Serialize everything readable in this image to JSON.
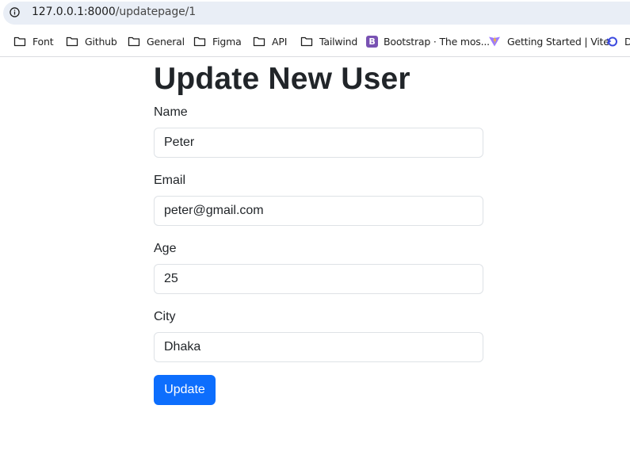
{
  "browser": {
    "url_host": "127.0.0.1:8000",
    "url_path": "/updatepage/1",
    "bookmarks": [
      {
        "label": "Font",
        "icon": "folder-icon"
      },
      {
        "label": "Github",
        "icon": "folder-icon"
      },
      {
        "label": "General",
        "icon": "folder-icon"
      },
      {
        "label": "Figma",
        "icon": "folder-icon"
      },
      {
        "label": "API",
        "icon": "folder-icon"
      },
      {
        "label": "Tailwind",
        "icon": "folder-icon"
      },
      {
        "label": "Bootstrap · The mos...",
        "icon": "bootstrap-icon",
        "icon_text": "B"
      },
      {
        "label": "Getting Started | Vite",
        "icon": "vite-icon"
      },
      {
        "label": "D",
        "icon": "devto-icon"
      }
    ]
  },
  "form": {
    "title": "Update New User",
    "fields": [
      {
        "label": "Name",
        "value": "Peter"
      },
      {
        "label": "Email",
        "value": "peter@gmail.com"
      },
      {
        "label": "Age",
        "value": "25"
      },
      {
        "label": "City",
        "value": "Dhaka"
      }
    ],
    "submit_label": "Update"
  },
  "colors": {
    "primary": "#0d6efd",
    "text": "#212529",
    "border": "#dee2e6",
    "address_bg": "#e9eef6"
  }
}
